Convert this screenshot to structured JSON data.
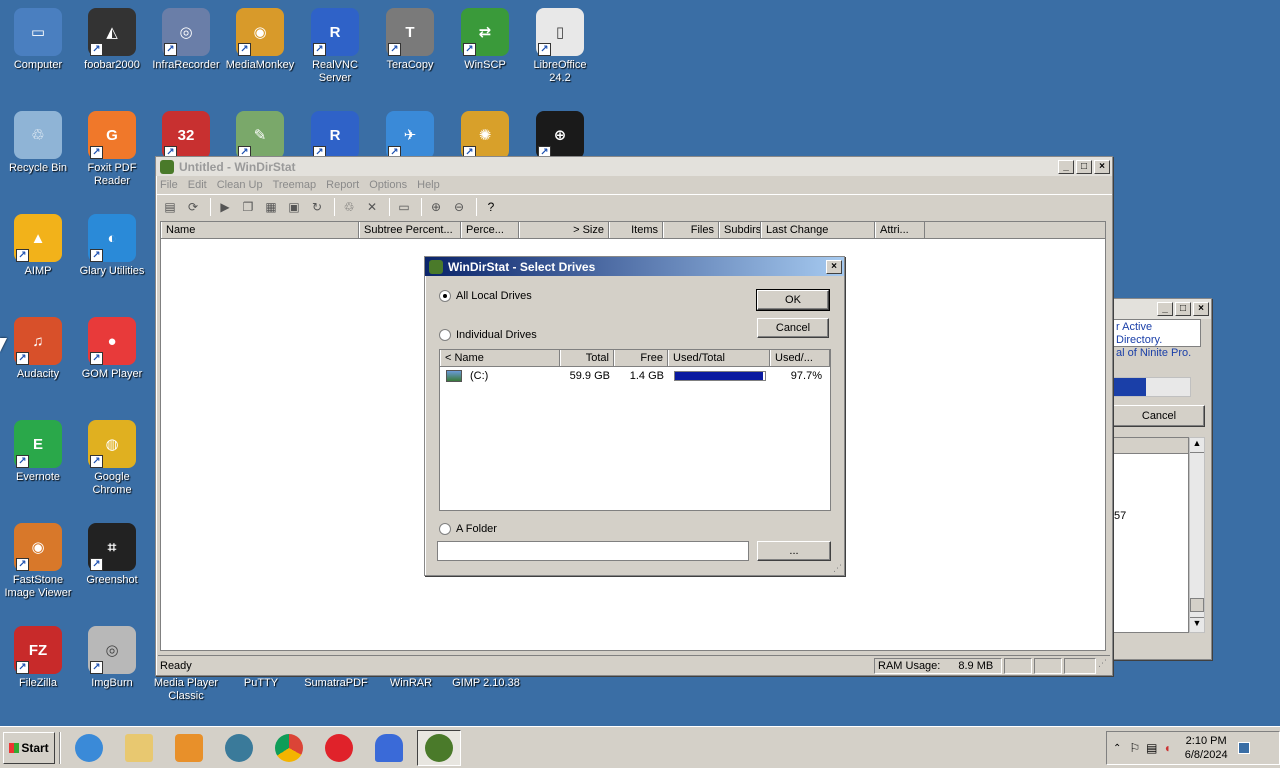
{
  "desktop": {
    "icons": [
      {
        "label": "Computer",
        "line2": "",
        "color": "#4a7fc0",
        "glyph": "▭",
        "icon": "computer-icon"
      },
      {
        "label": "foobar2000",
        "line2": "",
        "color": "#333333",
        "glyph": "◭",
        "icon": "foobar-icon"
      },
      {
        "label": "InfraRecorder",
        "line2": "",
        "color": "#6a7ea8",
        "glyph": "◎",
        "icon": "infrarecorder-icon"
      },
      {
        "label": "MediaMonkey",
        "line2": "",
        "color": "#d89a2a",
        "glyph": "◉",
        "icon": "mediamonkey-icon"
      },
      {
        "label": "RealVNC",
        "line2": "Server",
        "color": "#2f62c8",
        "glyph": "R",
        "icon": "realvnc-icon"
      },
      {
        "label": "TeraCopy",
        "line2": "",
        "color": "#7a7a7a",
        "glyph": "T",
        "icon": "teracopy-icon"
      },
      {
        "label": "WinSCP",
        "line2": "",
        "color": "#3a9a3a",
        "glyph": "⇄",
        "icon": "winscp-icon"
      },
      {
        "label": "LibreOffice",
        "line2": "24.2",
        "color": "#e8e8e8",
        "glyph": "▯",
        "icon": "libreoffice-icon"
      },
      {
        "label": "Recycle Bin",
        "line2": "",
        "color": "#8fb4d6",
        "glyph": "♲",
        "icon": "recycle-bin-icon"
      },
      {
        "label": "Foxit PDF",
        "line2": "Reader",
        "color": "#f0782a",
        "glyph": "G",
        "icon": "foxit-icon"
      },
      {
        "label": "",
        "line2": "",
        "color": "#c83030",
        "glyph": "32",
        "icon": "app-32-icon"
      },
      {
        "label": "",
        "line2": "",
        "color": "#7aa86a",
        "glyph": "✎",
        "icon": "notepad-icon"
      },
      {
        "label": "",
        "line2": "",
        "color": "#2f62c8",
        "glyph": "R",
        "icon": "realvnc-viewer-icon"
      },
      {
        "label": "",
        "line2": "",
        "color": "#3a8ad8",
        "glyph": "✈",
        "icon": "thunderbird-icon"
      },
      {
        "label": "",
        "line2": "",
        "color": "#d8a02a",
        "glyph": "✺",
        "icon": "app-sun-icon"
      },
      {
        "label": "",
        "line2": "",
        "color": "#1a1a1a",
        "glyph": "⊕",
        "icon": "keepass-icon"
      },
      {
        "label": "AIMP",
        "line2": "",
        "color": "#f2b21a",
        "glyph": "▲",
        "icon": "aimp-icon"
      },
      {
        "label": "Glary Utilities",
        "line2": "",
        "color": "#2a8ad8",
        "glyph": "◐",
        "icon": "glary-icon"
      },
      {
        "label": "Audacity",
        "line2": "",
        "color": "#d8502a",
        "glyph": "♫",
        "icon": "audacity-icon"
      },
      {
        "label": "GOM Player",
        "line2": "",
        "color": "#e83a3a",
        "glyph": "●",
        "icon": "gom-player-icon"
      },
      {
        "label": "Evernote",
        "line2": "",
        "color": "#2aa84a",
        "glyph": "E",
        "icon": "evernote-icon"
      },
      {
        "label": "Google",
        "line2": "Chrome",
        "color": "#e0b020",
        "glyph": "◍",
        "icon": "chrome-icon"
      },
      {
        "label": "FastStone",
        "line2": "Image Viewer",
        "color": "#d8782a",
        "glyph": "◉",
        "icon": "faststone-icon"
      },
      {
        "label": "Greenshot",
        "line2": "",
        "color": "#222222",
        "glyph": "⌗",
        "icon": "greenshot-icon"
      },
      {
        "label": "FileZilla",
        "line2": "",
        "color": "#c82a2a",
        "glyph": "FZ",
        "icon": "filezilla-icon"
      },
      {
        "label": "ImgBurn",
        "line2": "",
        "color": "#b8b8b8",
        "glyph": "◎",
        "icon": "imgburn-icon"
      }
    ],
    "bottom_labels": [
      "Media Player",
      "Classic",
      "PuTTY",
      "SumatraPDF",
      "WinRAR",
      "GIMP 2.10.38"
    ]
  },
  "main_window": {
    "title": "Untitled - WinDirStat",
    "menu": [
      "File",
      "Edit",
      "Clean Up",
      "Treemap",
      "Report",
      "Options",
      "Help"
    ],
    "columns": [
      "Name",
      "Subtree Percent...",
      "Perce...",
      "> Size",
      "Items",
      "Files",
      "Subdirs",
      "Last Change",
      "Attri..."
    ],
    "status_text": "Ready",
    "ram_label": "RAM Usage:",
    "ram_value": "8.9 MB"
  },
  "background_window": {
    "text_line1": "r Active Directory.",
    "text_line2": "al of Ninite Pro.",
    "cancel_label": "Cancel",
    "fragment": "57"
  },
  "dialog": {
    "title": "WinDirStat - Select Drives",
    "radio_all": "All Local Drives",
    "radio_individual": "Individual Drives",
    "radio_folder": "A Folder",
    "ok_label": "OK",
    "cancel_label": "Cancel",
    "browse_label": "...",
    "folder_value": "",
    "columns": [
      "< Name",
      "Total",
      "Free",
      "Used/Total",
      "Used/..."
    ],
    "drives": [
      {
        "name": "(C:)",
        "total": "59.9 GB",
        "free": "1.4 GB",
        "used_fraction": 0.977,
        "used_pct": "97.7%"
      }
    ]
  },
  "taskbar": {
    "start_label": "Start",
    "time": "2:10 PM",
    "date": "6/8/2024"
  }
}
